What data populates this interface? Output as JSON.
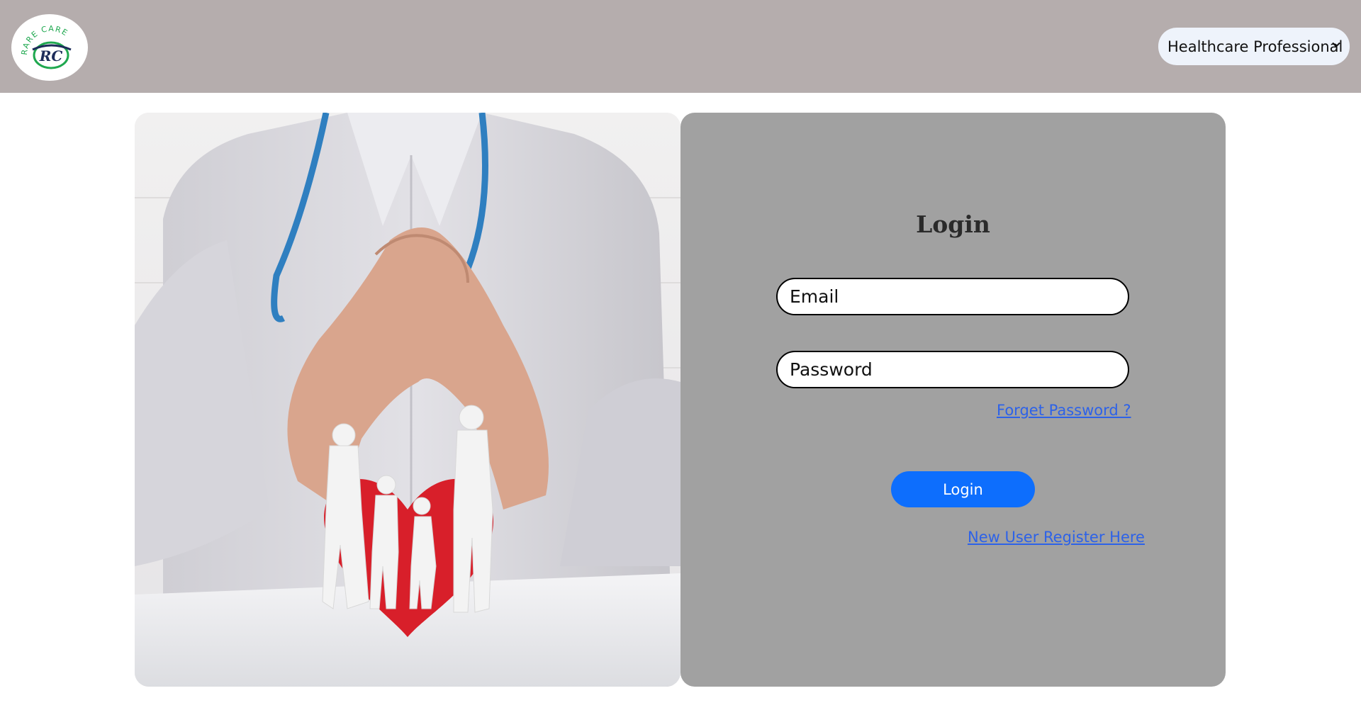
{
  "header": {
    "logo": {
      "text": "RARE CARE",
      "monogram": "RC",
      "icon": "rare-care-logo"
    },
    "role_select": {
      "selected": "Healthcare Professional",
      "icon": "chevron-down-icon"
    }
  },
  "hero": {
    "image": "doctor-hands-protecting-paper-family-with-heart"
  },
  "login": {
    "title": "Login",
    "email_placeholder": "Email",
    "password_placeholder": "Password",
    "forgot_label": "Forget Password ?",
    "login_button": "Login",
    "register_label": "New User Register Here"
  },
  "colors": {
    "header_bg": "#b5adad",
    "form_bg": "#a1a1a1",
    "primary": "#0d6efd",
    "link": "#2d62e8",
    "logo_green": "#1fa84f",
    "logo_navy": "#1d2c5a"
  }
}
